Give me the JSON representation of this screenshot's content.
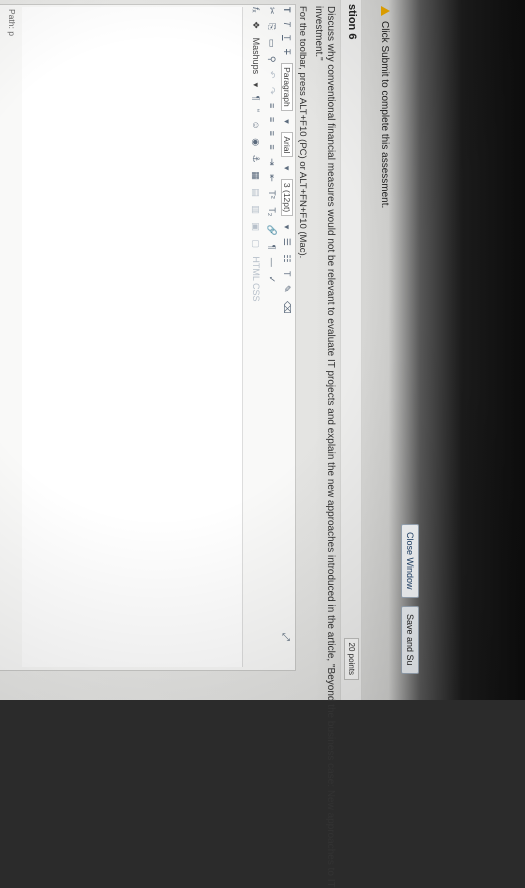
{
  "header": {
    "close_window_label": "Close Window",
    "save_submit_label": "Save and Su"
  },
  "notice": {
    "text": "Click Submit to complete this assessment."
  },
  "question": {
    "title": "stion 6",
    "points": "20 points",
    "prompt_line1": "Discuss why conventional financial measures would not be relevant to evaluate IT projects and explain the new approaches introduced in the article, \"Beyond the business case: New approaches to IT",
    "prompt_line2": "investment.\"",
    "toolbar_hint": "For the toolbar, press ALT+F10 (PC) or ALT+FN+F10 (Mac)."
  },
  "editor": {
    "format_select": "Paragraph",
    "font_select": "Arial",
    "size_select": "3 (12pt)",
    "mashups_label": "Mashups",
    "path_label": "Path: p",
    "html_css_label": "HTML CSS"
  },
  "colors": {
    "accent": "#1d3f66",
    "warning": "#e6a400"
  }
}
